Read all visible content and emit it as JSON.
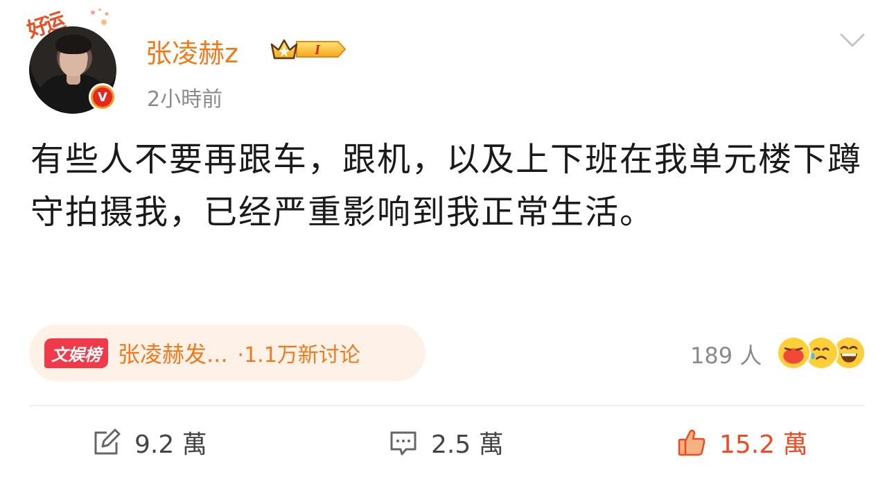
{
  "post": {
    "lucky_badge": "好运",
    "username": "张凌赫z",
    "vip_level": "I",
    "time": "2小時前",
    "content": "有些人不要再跟车，跟机，以及上下班在我单元楼下蹲守拍摄我，已经严重影响到我正常生活。"
  },
  "topic": {
    "tag": "文娱榜",
    "title": "张凌赫发...",
    "count": "·1.1万新讨论"
  },
  "reactions": {
    "count_label": "189 人",
    "emojis": [
      "angry-face-icon",
      "crying-face-icon",
      "laughing-face-icon"
    ]
  },
  "actions": {
    "repost": "9.2 萬",
    "comment": "2.5 萬",
    "like": "15.2 萬"
  },
  "colors": {
    "accent_orange": "#f07a1a",
    "like_red": "#f04a22",
    "tag_red": "#ef3a4a",
    "muted_gray": "#8a8a8a"
  }
}
